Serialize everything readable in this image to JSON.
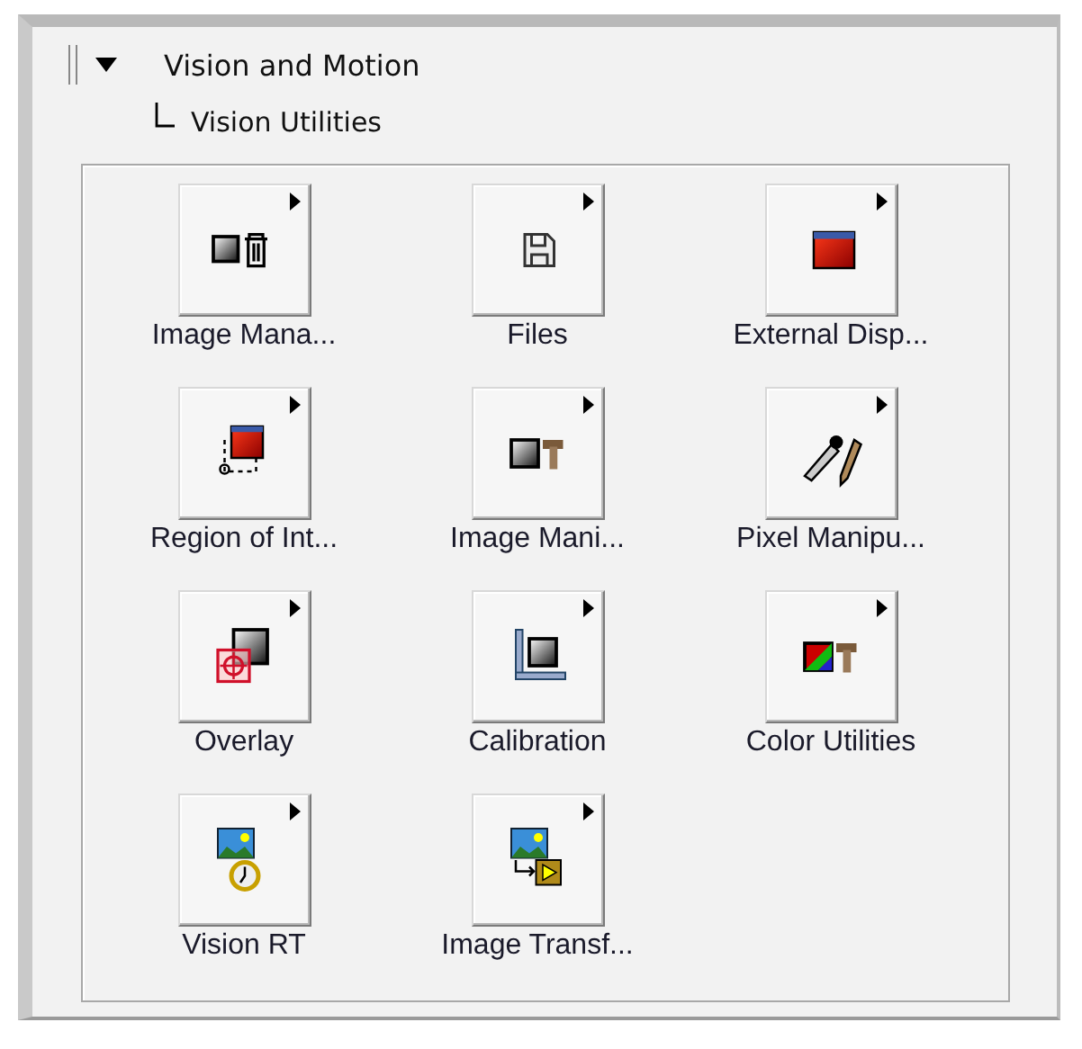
{
  "palette": {
    "category": {
      "label": "Vision and Motion",
      "expanded": true
    },
    "subcategory": {
      "label": "Vision Utilities"
    },
    "items": [
      {
        "label": "Image Mana...",
        "kind": "image-trash",
        "submenu": true
      },
      {
        "label": "Files",
        "kind": "floppy",
        "submenu": true
      },
      {
        "label": "External Disp...",
        "kind": "window",
        "submenu": true
      },
      {
        "label": "Region of Int...",
        "kind": "roi",
        "submenu": true
      },
      {
        "label": "Image Mani...",
        "kind": "image-hammer",
        "submenu": true
      },
      {
        "label": "Pixel Manipu...",
        "kind": "eyedropper",
        "submenu": true
      },
      {
        "label": "Overlay",
        "kind": "overlay",
        "submenu": true
      },
      {
        "label": "Calibration",
        "kind": "calibration",
        "submenu": true
      },
      {
        "label": "Color Utilities",
        "kind": "color-hammer",
        "submenu": true
      },
      {
        "label": "Vision RT",
        "kind": "vision-rt",
        "submenu": true
      },
      {
        "label": "Image Transf...",
        "kind": "transfer",
        "submenu": true
      }
    ]
  }
}
